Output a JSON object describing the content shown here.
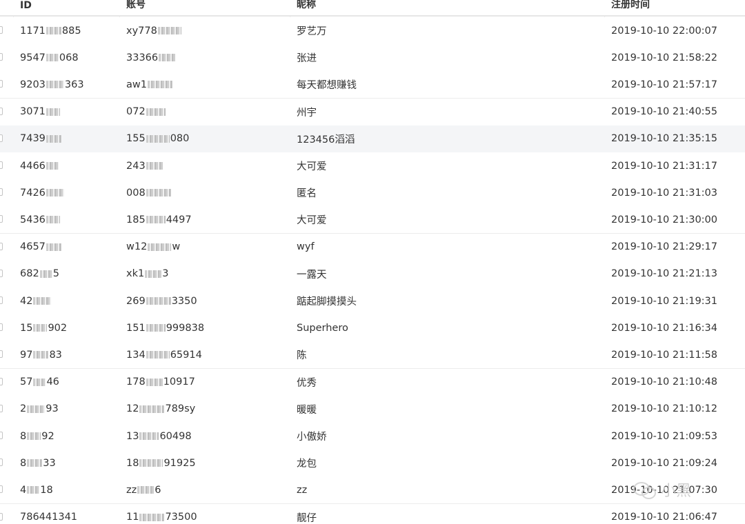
{
  "table": {
    "columns": [
      "ID",
      "账号",
      "昵称",
      "注册时间"
    ],
    "rows": [
      {
        "id_a": "1171",
        "id_b": "885",
        "acc_a": "xy778",
        "acc_b": "",
        "nick": "罗艺万",
        "time": "2019-10-10 22:00:07"
      },
      {
        "id_a": "9547",
        "id_b": "068",
        "acc_a": "33366",
        "acc_b": "",
        "nick": "张进",
        "time": "2019-10-10 21:58:22"
      },
      {
        "id_a": "9203",
        "id_b": "363",
        "acc_a": "aw1",
        "acc_b": "",
        "nick": "每天都想赚钱",
        "time": "2019-10-10 21:57:17"
      },
      {
        "id_a": "3071",
        "id_b": "",
        "acc_a": "072",
        "acc_b": "",
        "nick": "州宇",
        "time": "2019-10-10 21:40:55"
      },
      {
        "id_a": "7439",
        "id_b": "",
        "acc_a": "155",
        "acc_b": "080",
        "nick": "123456滔滔",
        "time": "2019-10-10 21:35:15"
      },
      {
        "id_a": "4466",
        "id_b": "",
        "acc_a": "243",
        "acc_b": "",
        "nick": "大可爱",
        "time": "2019-10-10 21:31:17"
      },
      {
        "id_a": "7426",
        "id_b": "",
        "acc_a": "008",
        "acc_b": "",
        "nick": "匿名",
        "time": "2019-10-10 21:31:03"
      },
      {
        "id_a": "5436",
        "id_b": "",
        "acc_a": "185",
        "acc_b": "4497",
        "nick": "大可爱",
        "time": "2019-10-10 21:30:00"
      },
      {
        "id_a": "4657",
        "id_b": "",
        "acc_a": "w12",
        "acc_b": "w",
        "nick": "wyf",
        "time": "2019-10-10 21:29:17"
      },
      {
        "id_a": "682",
        "id_b": "5",
        "acc_a": "xk1",
        "acc_b": "3",
        "nick": "一露天",
        "time": "2019-10-10 21:21:13"
      },
      {
        "id_a": "42",
        "id_b": "",
        "acc_a": "269",
        "acc_b": "3350",
        "nick": "踮起脚摸摸头",
        "time": "2019-10-10 21:19:31"
      },
      {
        "id_a": "15",
        "id_b": "902",
        "acc_a": "151",
        "acc_b": "999838",
        "nick": "Superhero",
        "time": "2019-10-10 21:16:34"
      },
      {
        "id_a": "97",
        "id_b": "83",
        "acc_a": "134",
        "acc_b": "65914",
        "nick": "陈",
        "time": "2019-10-10 21:11:58"
      },
      {
        "id_a": "57",
        "id_b": "46",
        "acc_a": "178",
        "acc_b": "10917",
        "nick": "优秀",
        "time": "2019-10-10 21:10:48"
      },
      {
        "id_a": "2",
        "id_b": "93",
        "acc_a": "12",
        "acc_b": "789sy",
        "nick": "暖暖",
        "time": "2019-10-10 21:10:12"
      },
      {
        "id_a": "8",
        "id_b": "92",
        "acc_a": "13",
        "acc_b": "60498",
        "nick": "小傲娇",
        "time": "2019-10-10 21:09:53"
      },
      {
        "id_a": "8",
        "id_b": "33",
        "acc_a": "18",
        "acc_b": "91925",
        "nick": "龙包",
        "time": "2019-10-10 21:09:24"
      },
      {
        "id_a": "4",
        "id_b": "18",
        "acc_a": "zz",
        "acc_b": "6",
        "nick": "zz",
        "time": "2019-10-10 21:07:30"
      },
      {
        "id_a": "786441341",
        "id_b": "",
        "acc_a": "11",
        "acc_b": "73500",
        "nick": "靓仔",
        "time": "2019-10-10 21:06:47"
      }
    ]
  },
  "watermark": {
    "text": "小黑",
    "icon": "wechat-icon"
  }
}
